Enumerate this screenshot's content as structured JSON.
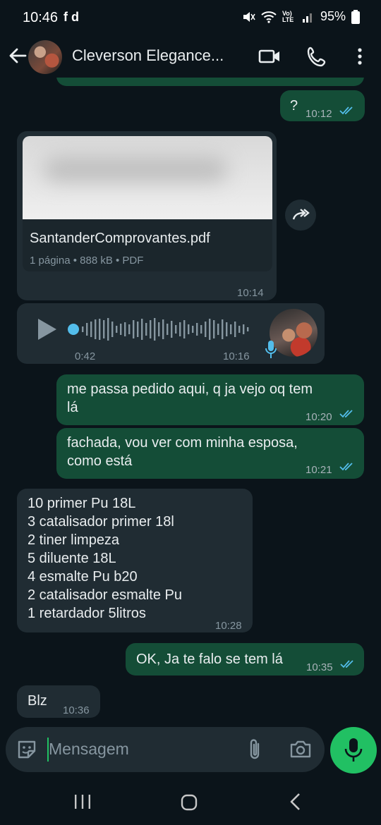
{
  "status_bar": {
    "time": "10:46",
    "left_icons": "f d",
    "right_icons_label": "Vo) LTE",
    "battery": "95%"
  },
  "header": {
    "contact_name": "Cleverson Elegance..."
  },
  "messages": {
    "m1": {
      "text": "?",
      "time": "10:12"
    },
    "doc": {
      "filename": "SantanderComprovantes.pdf",
      "meta": "1 página • 888 kB • PDF",
      "time": "10:14"
    },
    "audio": {
      "duration": "0:42",
      "time": "10:16",
      "progress": 0.0
    },
    "m2": {
      "text": "me  passa pedido aqui, q ja vejo oq tem\nlá",
      "time": "10:20"
    },
    "m3": {
      "text": "fachada, vou ver com minha esposa,\ncomo está",
      "time": "10:21"
    },
    "m4": {
      "text": "10 primer Pu 18L\n3 catalisador primer 18l\n2 tiner limpeza\n5 diluente 18L\n4 esmalte Pu b20\n2 catalisador esmalte Pu\n1 retardador 5litros",
      "time": "10:28"
    },
    "m5": {
      "text": "OK, Ja te falo se tem lá",
      "time": "10:35"
    },
    "m6": {
      "text": "Blz",
      "time": "10:36"
    }
  },
  "composer": {
    "placeholder": "Mensagem"
  },
  "colors": {
    "background": "#0b141a",
    "outgoing_bubble": "#144d37",
    "incoming_bubble": "#202c33",
    "read_ticks": "#53bdeb",
    "accent_green": "#21c063"
  }
}
